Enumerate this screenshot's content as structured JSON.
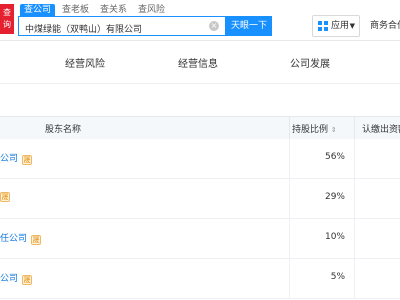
{
  "header": {
    "logo_text": "查\n询",
    "tabs": [
      "查公司",
      "查老板",
      "查关系",
      "查风险"
    ],
    "active_tab": 0,
    "search_value": "中煤绿能（双鸭山）有限公司",
    "search_button": "天眼一下",
    "app_button": "应用",
    "biz_link": "商务合作"
  },
  "subnav": {
    "items": [
      "经营风险",
      "经营信息",
      "公司发展"
    ]
  },
  "table": {
    "headers": {
      "shareholder": "股东名称",
      "ratio": "持股比例",
      "subscribed": "认缴出资额"
    },
    "rows": [
      {
        "name": "公司",
        "badge": "晟",
        "ratio": "56%"
      },
      {
        "name": "",
        "badge": "晟",
        "ratio": "29%"
      },
      {
        "name": "任公司",
        "badge": "晟",
        "ratio": "10%"
      },
      {
        "name": "公司",
        "badge": "晟",
        "ratio": "5%"
      }
    ]
  },
  "colors": {
    "primary": "#1890ff",
    "link": "#1177dd",
    "logo_red": "#e5202f"
  }
}
